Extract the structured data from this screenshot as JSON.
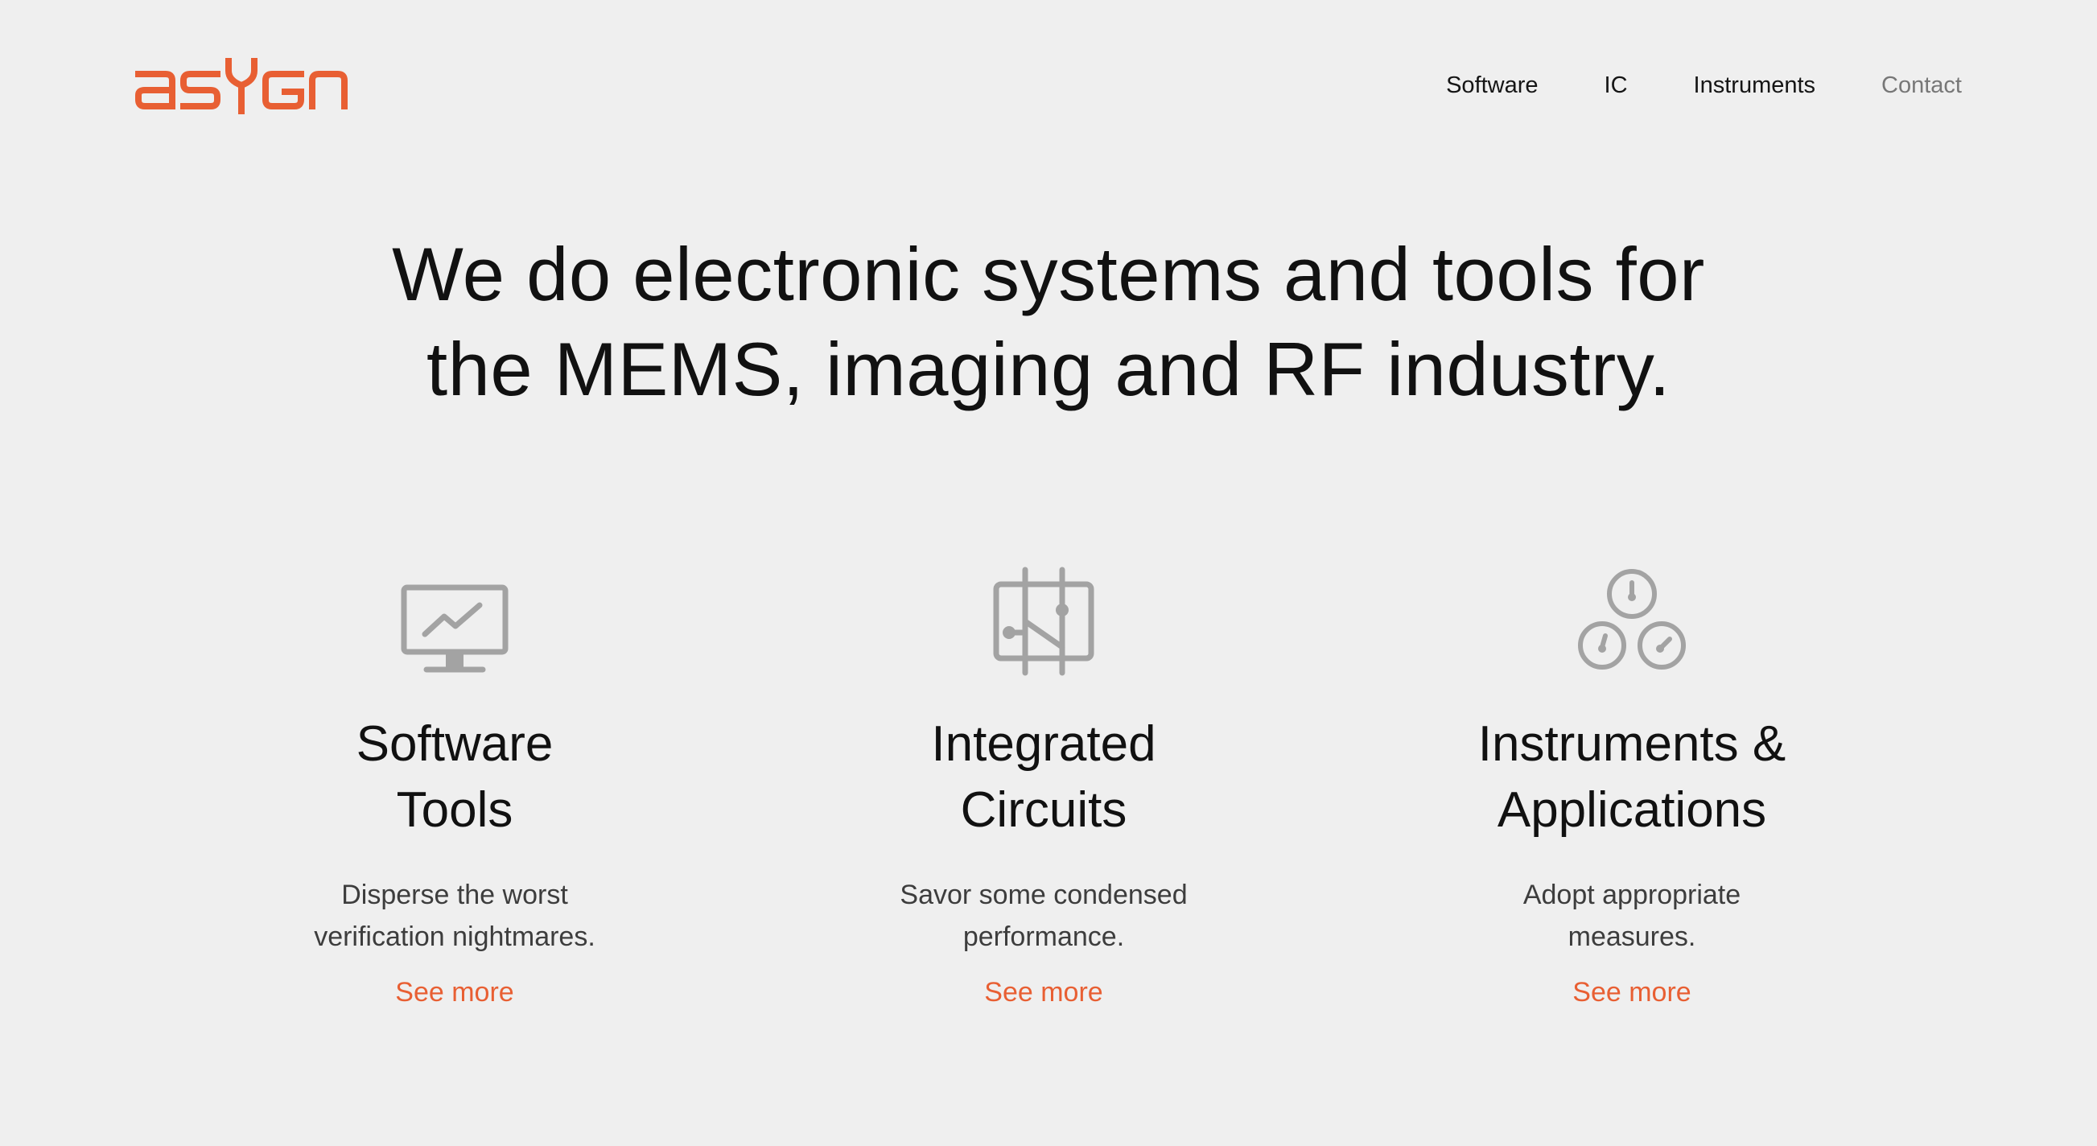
{
  "brand": {
    "logo_text": "asygn",
    "accent": "#e85f33"
  },
  "nav": {
    "items": [
      {
        "label": "Software"
      },
      {
        "label": "IC"
      },
      {
        "label": "Instruments"
      },
      {
        "label": "Contact"
      }
    ]
  },
  "hero": {
    "line1": "We do electronic systems and tools for",
    "line2": "the MEMS, imaging and RF industry."
  },
  "features": [
    {
      "icon": "monitor-chart-icon",
      "title_line1": "Software",
      "title_line2": "Tools",
      "desc_line1": "Disperse the worst",
      "desc_line2": "verification nightmares.",
      "link": "See more"
    },
    {
      "icon": "chip-circuit-icon",
      "title_line1": "Integrated",
      "title_line2": "Circuits",
      "desc_line1": "Savor some condensed",
      "desc_line2": "performance.",
      "link": "See more"
    },
    {
      "icon": "gauges-icon",
      "title_line1": "Instruments &",
      "title_line2": "Applications",
      "desc_line1": "Adopt appropriate",
      "desc_line2": "measures.",
      "link": "See more"
    }
  ]
}
